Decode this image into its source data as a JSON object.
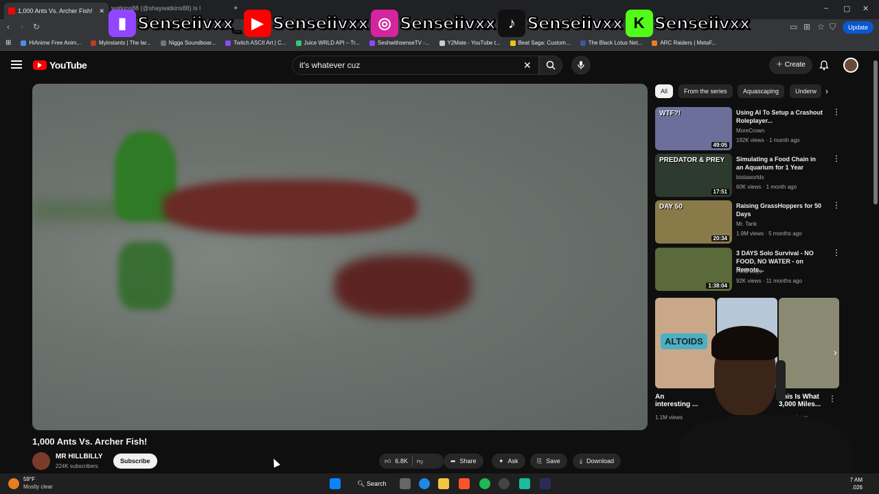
{
  "browser": {
    "active_tab_title": "1,000 Ants Vs. Archer Fish!",
    "second_tab_title": "watkins88 (@shaywatkins88) is l",
    "update_label": "Update",
    "bookmarks": [
      {
        "label": "HiAnime Free Anim...",
        "color": "#4a90e2"
      },
      {
        "label": "Myinstants | The lar...",
        "color": "#c0392b"
      },
      {
        "label": "Nigga Soundboar...",
        "color": "#777777"
      },
      {
        "label": "Twitch ASCII Art | C...",
        "color": "#9146ff"
      },
      {
        "label": "Juice WRLD API – Tr...",
        "color": "#2ecc71"
      },
      {
        "label": "SeshwithsenseTV -...",
        "color": "#9146ff"
      },
      {
        "label": "Y2Mate - YouTube t...",
        "color": "#cccccc"
      },
      {
        "label": "Beat Saga: Custom...",
        "color": "#f1c40f"
      },
      {
        "label": "The Black Lotus Net...",
        "color": "#3b5998"
      },
      {
        "label": "ARC Raiders | MetaF...",
        "color": "#e67e22"
      }
    ]
  },
  "social_overlay": [
    {
      "platform": "twitch-icon",
      "handle": "Senseiivxx_",
      "color": "#9146ff",
      "glyph": "▮"
    },
    {
      "platform": "youtube-icon",
      "handle": "Senseiivxx",
      "color": "#ff0000",
      "glyph": "▶"
    },
    {
      "platform": "instagram-icon",
      "handle": "Senseiivxx",
      "color": "#d6249f",
      "glyph": "◎"
    },
    {
      "platform": "tiktok-icon",
      "handle": "Senseiivxx",
      "color": "#111111",
      "glyph": "♪"
    },
    {
      "platform": "kick-icon",
      "handle": "Senseiivxx",
      "color": "#53fc18",
      "glyph": "K"
    }
  ],
  "youtube": {
    "logo": "YouTube",
    "search_value": "it's whatever cuz",
    "create_label": "Create"
  },
  "video": {
    "title": "1,000 Ants Vs. Archer Fish!",
    "channel": "MR HILLBILLY",
    "subscribers": "224K subscribers",
    "subscribe_label": "Subscribe",
    "likes": "6.8K",
    "share_label": "Share",
    "ask_label": "Ask",
    "save_label": "Save",
    "download_label": "Download"
  },
  "chips": [
    "All",
    "From the series",
    "Aquascaping",
    "Underw"
  ],
  "recommendations": [
    {
      "title": "Using AI To Setup a Crashout Roleplayer...",
      "channel": "MoreCrown",
      "meta": "192K views · 1 month ago",
      "duration": "49:05",
      "thumb_color": "#6b6f9a",
      "thumb_text": "WTF?!"
    },
    {
      "title": "Simulating a Food Chain in an Aquarium for 1 Year",
      "channel": "biotaworlds",
      "meta": "60K views · 1 month ago",
      "duration": "17:51",
      "thumb_color": "#2d3a2e",
      "thumb_text": "PREDATOR & PREY"
    },
    {
      "title": "Raising GrassHoppers for 50 Days",
      "channel": "Mr. Tank",
      "meta": "1.9M views · 5 months ago",
      "duration": "20:34",
      "thumb_color": "#8a7a4a",
      "thumb_text": "DAY 50"
    },
    {
      "title": "3 DAYS Solo Survival - NO FOOD, NO WATER - on Remote...",
      "channel": "Field Days",
      "meta": "92K views · 11 months ago",
      "duration": "1:38:04",
      "thumb_color": "#5a6a3a",
      "thumb_text": ""
    }
  ],
  "shorts": [
    {
      "label": "An interesting ...",
      "views": "1.1M views",
      "color": "#c9a88a",
      "badge": "ALTOIDS"
    },
    {
      "label": "",
      "views": "",
      "color": "#b7c7d7",
      "badge": ""
    },
    {
      "label": "This Is What 3,000 Miles...",
      "views": "views",
      "color": "#8a8a72",
      "badge": ""
    }
  ],
  "taskbar": {
    "temp": "59°F",
    "weather": "Mostly clear",
    "search_label": "Search",
    "time": "7 AM",
    "date": ".026"
  }
}
